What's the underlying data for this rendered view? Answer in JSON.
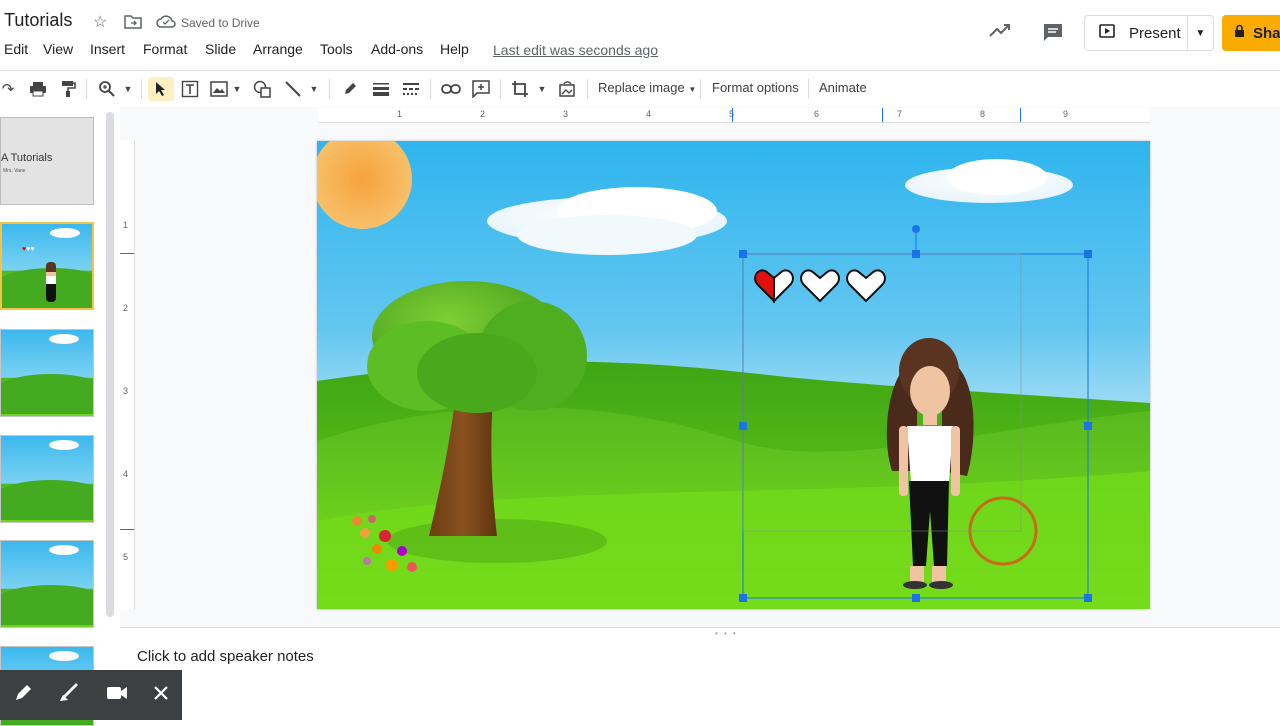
{
  "header": {
    "title": "Tutorials",
    "saved_status": "Saved to Drive",
    "star_icon": "star-icon",
    "move_icon": "move-to-folder-icon",
    "cloud_icon": "cloud-saved-icon"
  },
  "menu": {
    "items": [
      "Edit",
      "View",
      "Insert",
      "Format",
      "Slide",
      "Arrange",
      "Tools",
      "Add-ons",
      "Help"
    ],
    "last_edit": "Last edit was seconds ago"
  },
  "actions": {
    "activity_icon": "trend-icon",
    "comments_icon": "comment-icon",
    "present_label": "Present",
    "share_label": "Sha"
  },
  "toolbar": {
    "replace_image": "Replace image",
    "format_options": "Format options",
    "animate": "Animate"
  },
  "filmstrip": {
    "first_slide_title": "A Tutorials",
    "first_slide_subtitle": "Mrs. Vane"
  },
  "rulers": {
    "horizontal": [
      "1",
      "2",
      "3",
      "4",
      "5",
      "6",
      "7",
      "8",
      "9"
    ],
    "vertical": [
      "1",
      "2",
      "3",
      "4",
      "5"
    ]
  },
  "notes": {
    "placeholder": "Click to add speaker notes"
  },
  "recorder": {
    "icons": [
      "pen-icon",
      "highlighter-icon",
      "camera-icon",
      "close-icon"
    ]
  },
  "colors": {
    "accent_blue": "#1a73e8",
    "share_yellow": "#f9ab00",
    "sky": "#2fb5ee",
    "grass": "#6fd51c"
  }
}
